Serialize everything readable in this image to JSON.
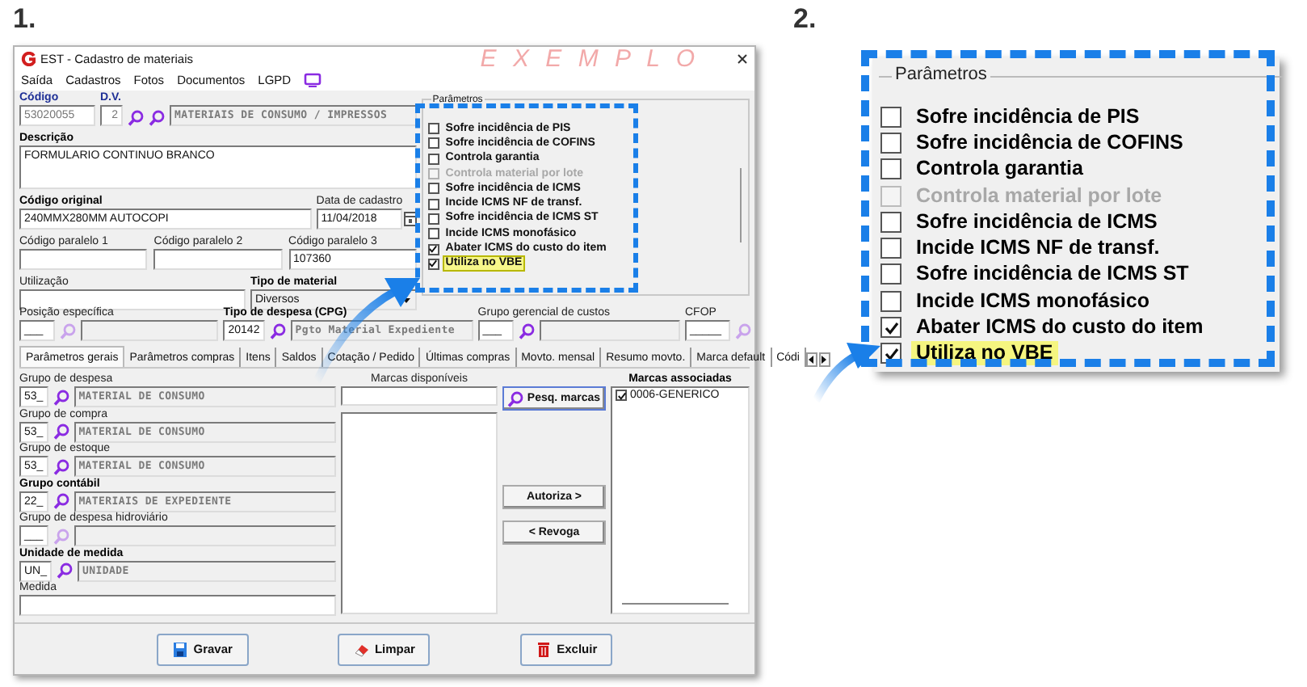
{
  "steps": [
    "1.",
    "2."
  ],
  "window": {
    "title": "EST - Cadastro de materiais",
    "watermark": "E X E M P L O"
  },
  "menu": [
    {
      "label": "Saída"
    },
    {
      "label": "Cadastros"
    },
    {
      "label": "Fotos"
    },
    {
      "label": "Documentos"
    },
    {
      "label": "LGPD"
    }
  ],
  "header": {
    "code": {
      "label": "Código",
      "bold": true,
      "key": true,
      "value": "53020055"
    },
    "dv": {
      "label": "D.V.",
      "bold": true,
      "key": true,
      "value": "2"
    },
    "category": {
      "value": "MATERIAIS DE CONSUMO / IMPRESSOS"
    },
    "description": {
      "label": "Descrição",
      "bold": true,
      "value": "FORMULARIO CONTINUO BRANCO"
    },
    "original_code": {
      "label": "Código original",
      "bold": true,
      "value": "240MMX280MM AUTOCOPI"
    },
    "registration_date": {
      "label": "Data de cadastro",
      "bold": false,
      "value": "11/04/2018"
    },
    "parallel_codes": [
      {
        "label": "Código paralelo 1",
        "bold": false
      },
      {
        "label": "Código paralelo 2",
        "bold": false
      },
      {
        "label": "Código paralelo 3",
        "bold": false,
        "value": "107360"
      }
    ],
    "usage": {
      "label": "Utilização",
      "bold": false
    },
    "material_type": {
      "label": "Tipo de material",
      "bold": true,
      "value": "Diversos"
    }
  },
  "lookups": [
    {
      "kind": "code_desc",
      "label": "Posição específica",
      "bold": false,
      "code": "___",
      "search_enabled": false
    },
    {
      "kind": "code_desc",
      "label": "Tipo de despesa (CPG)",
      "bold": true,
      "code": "20142",
      "search_enabled": true,
      "description": "Pgto Material Expediente"
    },
    {
      "kind": "code_desc",
      "label": "Grupo gerencial de custos",
      "bold": false,
      "code": "___",
      "search_enabled": true
    },
    {
      "kind": "code_only",
      "label": "CFOP",
      "bold": false,
      "code": "_____",
      "search_enabled": false
    }
  ],
  "parameters": {
    "legend": "Parâmetros",
    "items": [
      {
        "label": "Sofre incidência de PIS",
        "checked": false,
        "disabled": false,
        "highlighted": false
      },
      {
        "label": "Sofre incidência de COFINS",
        "checked": false,
        "disabled": false,
        "highlighted": false
      },
      {
        "label": "Controla garantia",
        "checked": false,
        "disabled": false,
        "highlighted": false
      },
      {
        "label": "Controla material por lote",
        "checked": false,
        "disabled": true,
        "highlighted": false
      },
      {
        "label": "Sofre incidência de ICMS",
        "checked": false,
        "disabled": false,
        "highlighted": false
      },
      {
        "label": "Incide ICMS NF de transf.",
        "checked": false,
        "disabled": false,
        "highlighted": false
      },
      {
        "label": "Sofre incidência de ICMS ST",
        "checked": false,
        "disabled": false,
        "highlighted": false
      },
      {
        "label": "Incide ICMS monofásico",
        "checked": false,
        "disabled": false,
        "highlighted": false
      },
      {
        "label": "Abater ICMS do custo do item",
        "checked": true,
        "disabled": false,
        "highlighted": false
      },
      {
        "label": "Utiliza no VBE",
        "checked": true,
        "disabled": false,
        "highlighted": true
      }
    ]
  },
  "tabs": [
    {
      "label": "Parâmetros gerais",
      "selected": true
    },
    {
      "label": "Parâmetros compras",
      "selected": false
    },
    {
      "label": "Itens",
      "selected": false
    },
    {
      "label": "Saldos",
      "selected": false
    },
    {
      "label": "Cotação / Pedido",
      "selected": false
    },
    {
      "label": "Últimas compras",
      "selected": false
    },
    {
      "label": "Movto. mensal",
      "selected": false
    },
    {
      "label": "Resumo movto.",
      "selected": false
    },
    {
      "label": "Marca default",
      "selected": false
    },
    {
      "label": "Códi",
      "selected": false
    }
  ],
  "groups": [
    {
      "kind": "code_desc",
      "label": "Grupo de despesa",
      "bold": false,
      "code": "53_",
      "search_enabled": true,
      "description": "MATERIAL DE CONSUMO"
    },
    {
      "kind": "code_desc",
      "label": "Grupo de compra",
      "bold": false,
      "code": "53_",
      "search_enabled": true,
      "description": "MATERIAL DE CONSUMO"
    },
    {
      "kind": "code_desc",
      "label": "Grupo de estoque",
      "bold": false,
      "code": "53_",
      "search_enabled": true,
      "description": "MATERIAL DE CONSUMO"
    },
    {
      "kind": "code_desc",
      "label": "Grupo contábil",
      "bold": true,
      "code": "22_",
      "search_enabled": true,
      "description": "MATERIAIS DE EXPEDIENTE"
    },
    {
      "kind": "code_desc",
      "label": "Grupo de despesa hidroviário",
      "bold": false,
      "code": "___",
      "search_enabled": false
    },
    {
      "kind": "code_desc",
      "label": "Unidade de medida",
      "bold": true,
      "code": "UN_",
      "search_enabled": true,
      "description": "UNIDADE"
    },
    {
      "kind": "text",
      "label": "Medida",
      "bold": false
    }
  ],
  "brands": {
    "available_label": "Marcas disponíveis",
    "associated_label": "Marcas associadas",
    "buttons": [
      {
        "kind": "search",
        "label": "Pesq. marcas"
      },
      {
        "kind": "plain",
        "label": "Autoriza >"
      },
      {
        "kind": "plain",
        "label": "< Revoga"
      }
    ],
    "associated": [
      {
        "label": "0006-GENERICO",
        "checked": true
      }
    ]
  },
  "actions": [
    {
      "kind": "save",
      "label": "Gravar"
    },
    {
      "kind": "clear",
      "label": "Limpar"
    },
    {
      "kind": "delete",
      "label": "Excluir"
    }
  ],
  "zoom": {
    "legend": "Parâmetros",
    "items": [
      {
        "label": "Sofre incidência de PIS",
        "checked": false,
        "disabled": false,
        "highlighted": false
      },
      {
        "label": "Sofre incidência de COFINS",
        "checked": false,
        "disabled": false,
        "highlighted": false
      },
      {
        "label": "Controla garantia",
        "checked": false,
        "disabled": false,
        "highlighted": false
      },
      {
        "label": "Controla material por lote",
        "checked": false,
        "disabled": true,
        "highlighted": false
      },
      {
        "label": "Sofre incidência de ICMS",
        "checked": false,
        "disabled": false,
        "highlighted": false
      },
      {
        "label": "Incide ICMS NF de transf.",
        "checked": false,
        "disabled": false,
        "highlighted": false
      },
      {
        "label": "Sofre incidência de ICMS ST",
        "checked": false,
        "disabled": false,
        "highlighted": false
      },
      {
        "label": "Incide ICMS monofásico",
        "checked": false,
        "disabled": false,
        "highlighted": false
      },
      {
        "label": "Abater ICMS do custo do item",
        "checked": true,
        "disabled": false,
        "highlighted": false
      },
      {
        "label": "Utiliza no VBE",
        "checked": true,
        "disabled": false,
        "highlighted": true
      }
    ]
  }
}
